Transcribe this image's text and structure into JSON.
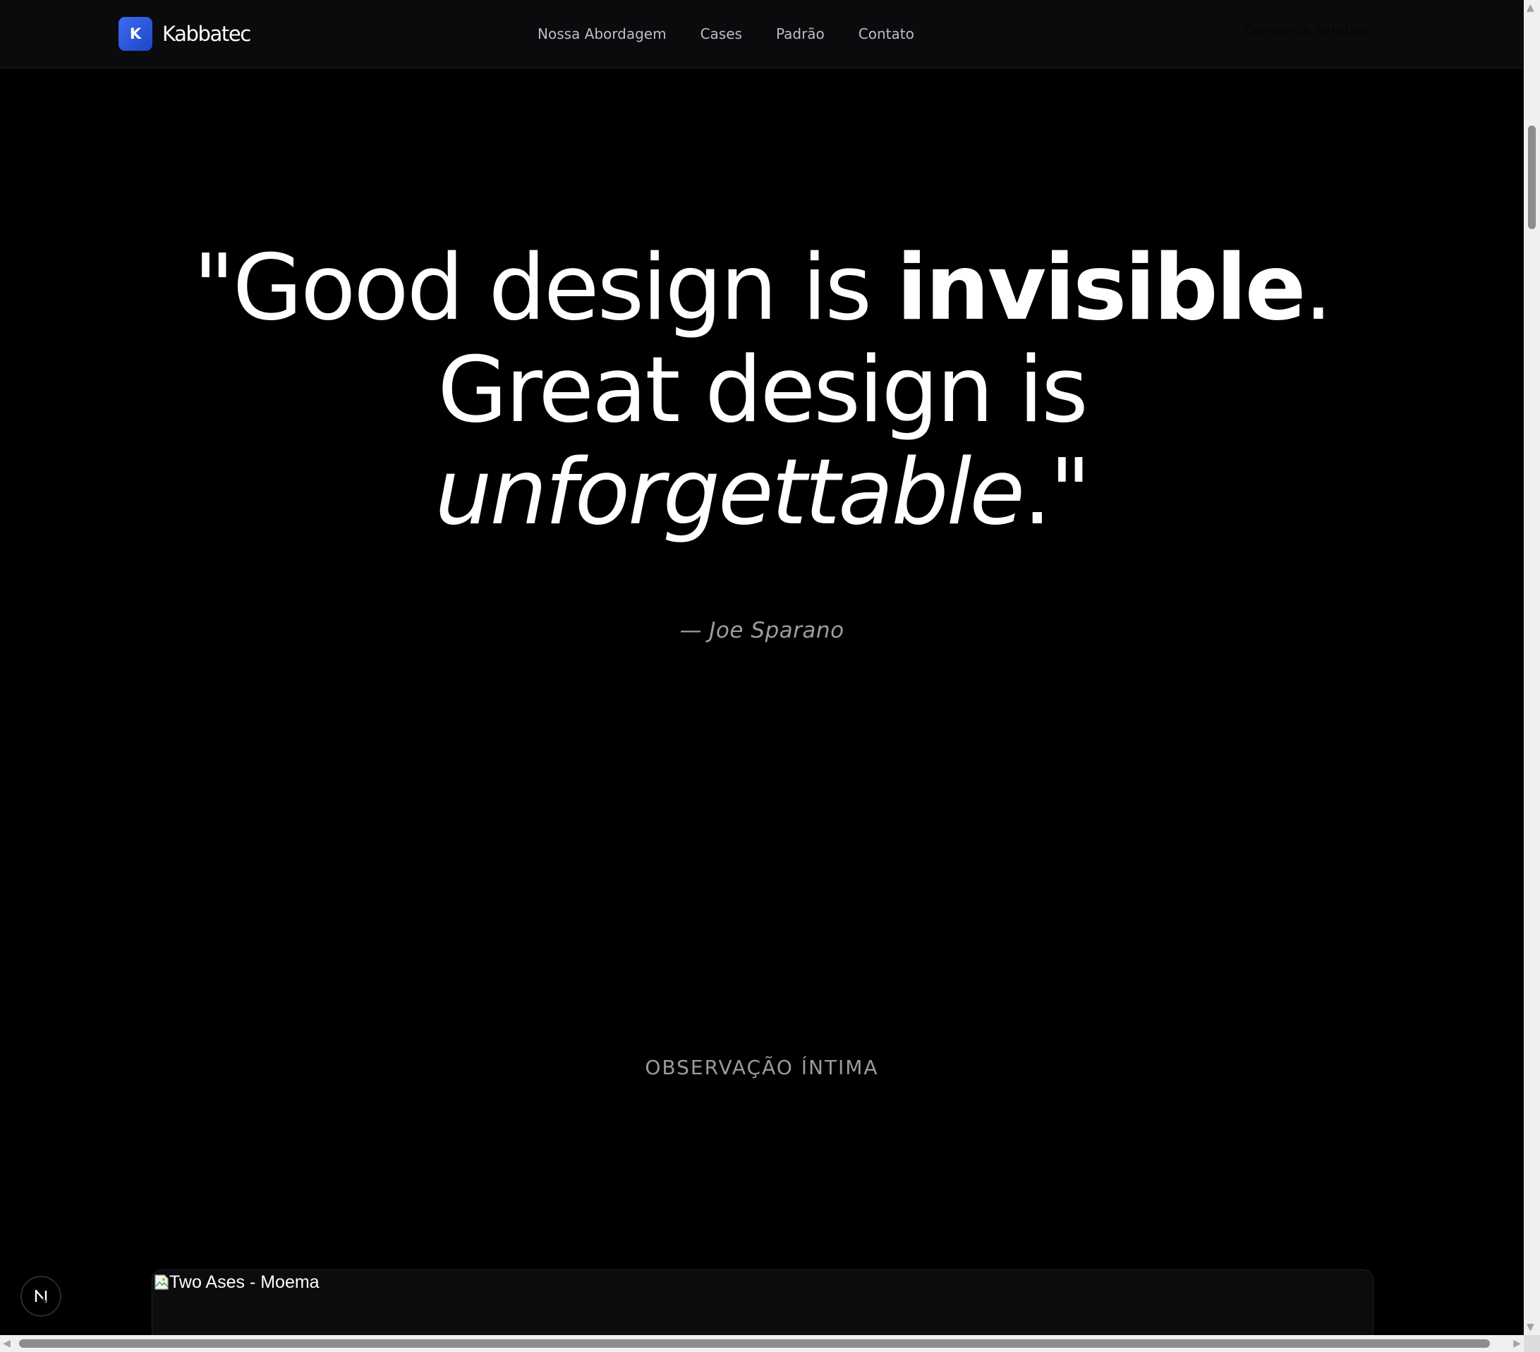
{
  "header": {
    "brand_initial": "K",
    "brand_name": "Kabbatec",
    "nav": [
      {
        "label": "Nossa Abordagem"
      },
      {
        "label": "Cases"
      },
      {
        "label": "Padrão"
      },
      {
        "label": "Contato"
      }
    ],
    "cta_label": "Conversa Seletiva"
  },
  "hero": {
    "quote_line1_a": "\"Good design is ",
    "quote_line1_b": "invisible",
    "quote_line1_c": ".",
    "quote_line2": "Great design is",
    "quote_line3_a": "unforgettable",
    "quote_line3_b": ".\"",
    "attribution": "— Joe Sparano"
  },
  "section": {
    "label": "OBSERVAÇÃO ÍNTIMA"
  },
  "case_card": {
    "image_alt": "Two Ases - Moema"
  },
  "floating_badge": {
    "letter": "N"
  },
  "colors": {
    "background": "#000000",
    "navbar": "#0b0b0d",
    "brand_accent": "#2f5de8",
    "text_primary": "#ffffff",
    "text_muted": "#9c9ca3"
  },
  "icons": {
    "brand": "k-logo-icon",
    "broken_image": "broken-image-icon",
    "badge": "n-badge-icon"
  }
}
